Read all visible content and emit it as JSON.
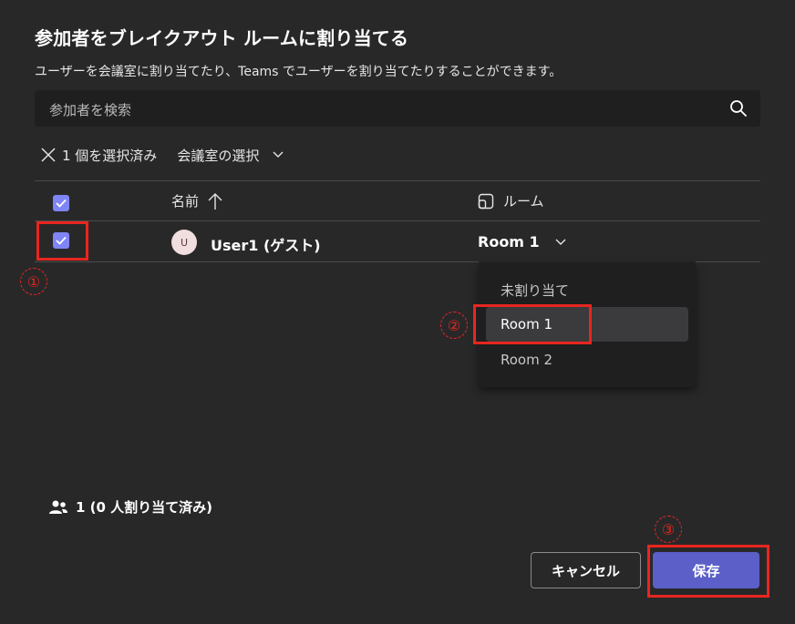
{
  "dialog": {
    "title": "参加者をブレイクアウト ルームに割り当てる",
    "description": "ユーザーを会議室に割り当てたり、Teams でユーザーを割り当てたりすることができます。"
  },
  "search": {
    "placeholder": "参加者を検索",
    "icon": "search-icon"
  },
  "selection_bar": {
    "count_text": "1 個を選択済み",
    "action_label": "会議室の選択"
  },
  "table": {
    "columns": {
      "name": "名前",
      "room": "ルーム"
    },
    "rows": [
      {
        "avatar_initial": "U",
        "name": "User1 (ゲスト)",
        "room": "Room 1",
        "checked": true
      }
    ]
  },
  "room_dropdown": {
    "options": [
      "未割り当て",
      "Room 1",
      "Room 2"
    ],
    "selected": "Room 1"
  },
  "annotations": [
    "①",
    "②",
    "③"
  ],
  "footer": {
    "count_text": "1 (0 人割り当て済み)"
  },
  "buttons": {
    "cancel": "キャンセル",
    "save": "保存"
  },
  "colors": {
    "accent": "#5b5fc7",
    "checkbox": "#7f85f5",
    "highlight": "#e8261f",
    "background": "#292829"
  }
}
